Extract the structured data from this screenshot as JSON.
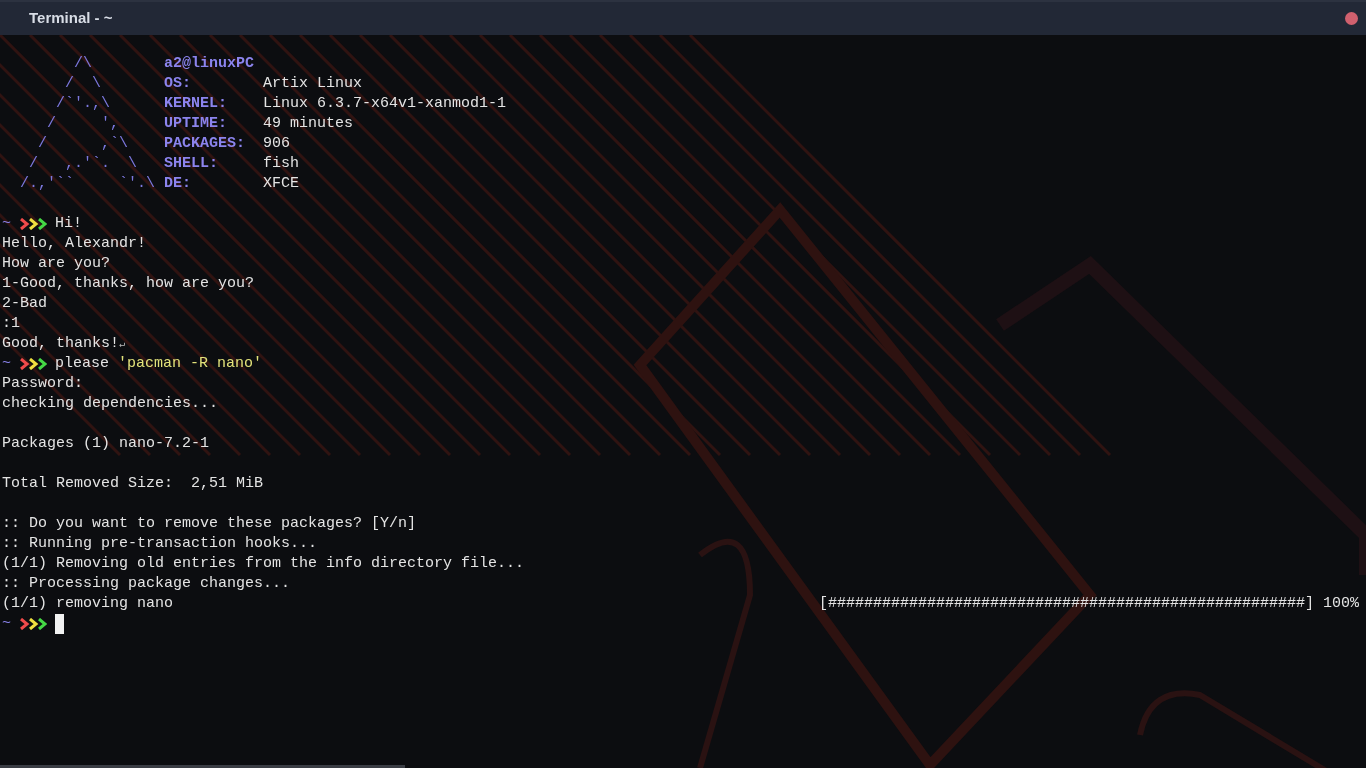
{
  "window": {
    "title": "Terminal - ~"
  },
  "neofetch": {
    "logo": [
      "        /\\",
      "       /  \\",
      "      /`'.,\\",
      "     /     ',",
      "    /      ,`\\",
      "   /   ,.'`.  \\",
      "  /.,'``     `'.\\"
    ],
    "user": "a2@linuxPC",
    "fields": [
      {
        "label": "OS:",
        "value": "Artix Linux"
      },
      {
        "label": "KERNEL:",
        "value": "Linux 6.3.7-x64v1-xanmod1-1"
      },
      {
        "label": "UPTIME:",
        "value": "49 minutes"
      },
      {
        "label": "PACKAGES:",
        "value": "906"
      },
      {
        "label": "SHELL:",
        "value": "fish"
      },
      {
        "label": "DE:",
        "value": "XFCE"
      }
    ]
  },
  "lines": [
    {
      "kind": "blank"
    },
    {
      "kind": "prompt",
      "dir": "~",
      "command": "Hi!"
    },
    {
      "kind": "output",
      "text": "Hello, Alexandr!"
    },
    {
      "kind": "output",
      "text": "How are you?"
    },
    {
      "kind": "output",
      "text": "1-Good, thanks, how are you?"
    },
    {
      "kind": "output",
      "text": "2-Bad"
    },
    {
      "kind": "output",
      "text": ":1"
    },
    {
      "kind": "output",
      "text": "Good, thanks!",
      "end_mark": "↵"
    },
    {
      "kind": "prompt",
      "dir": "~",
      "command": "please",
      "argument": "'pacman -R nano'"
    },
    {
      "kind": "output",
      "text": "Password:"
    },
    {
      "kind": "output",
      "text": "checking dependencies..."
    },
    {
      "kind": "blank"
    },
    {
      "kind": "output",
      "text": "Packages (1) nano-7.2-1"
    },
    {
      "kind": "blank"
    },
    {
      "kind": "output",
      "text": "Total Removed Size:  2,51 MiB"
    },
    {
      "kind": "blank"
    },
    {
      "kind": "output",
      "text": ":: Do you want to remove these packages? [Y/n]"
    },
    {
      "kind": "output",
      "text": ":: Running pre-transaction hooks..."
    },
    {
      "kind": "output",
      "text": "(1/1) Removing old entries from the info directory file..."
    },
    {
      "kind": "output",
      "text": ":: Processing package changes..."
    },
    {
      "kind": "progress",
      "text": "(1/1) removing nano",
      "bar": "[#####################################################]",
      "percent": "100%"
    },
    {
      "kind": "prompt",
      "dir": "~",
      "cursor": true
    }
  ]
}
